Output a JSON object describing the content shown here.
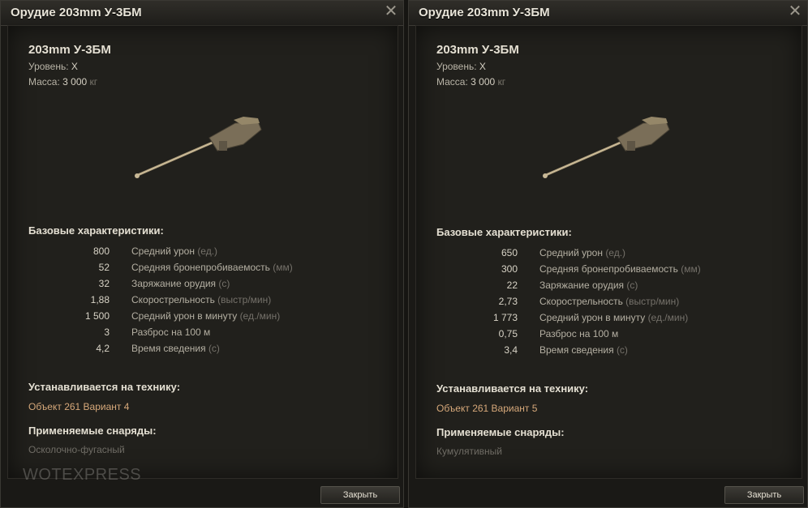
{
  "left": {
    "window_title": "Орудие 203mm У-3БМ",
    "gun_name": "203mm У-3БМ",
    "level_label": "Уровень:",
    "level_value": "X",
    "mass_label": "Масса:",
    "mass_value": "3 000",
    "mass_unit": "кг",
    "base_header": "Базовые характеристики:",
    "stats": [
      {
        "value": "800",
        "label": "Средний урон",
        "unit": "(ед.)"
      },
      {
        "value": "52",
        "label": "Средняя бронепробиваемость",
        "unit": "(мм)"
      },
      {
        "value": "32",
        "label": "Заряжание орудия",
        "unit": "(с)"
      },
      {
        "value": "1,88",
        "label": "Скорострельность",
        "unit": "(выстр/мин)"
      },
      {
        "value": "1 500",
        "label": "Средний урон в минуту",
        "unit": "(ед./мин)"
      },
      {
        "value": "3",
        "label": "Разброс на 100 м",
        "unit": ""
      },
      {
        "value": "4,2",
        "label": "Время сведения",
        "unit": "(с)"
      }
    ],
    "installed_header": "Устанавливается на технику:",
    "vehicle": "Объект 261 Вариант 4",
    "shells_header": "Применяемые снаряды:",
    "shell": "Осколочно-фугасный",
    "close_button": "Закрыть",
    "watermark": "WOTEXPRESS"
  },
  "right": {
    "window_title": "Орудие 203mm У-3БМ",
    "gun_name": "203mm У-3БМ",
    "level_label": "Уровень:",
    "level_value": "X",
    "mass_label": "Масса:",
    "mass_value": "3 000",
    "mass_unit": "кг",
    "base_header": "Базовые характеристики:",
    "stats": [
      {
        "value": "650",
        "label": "Средний урон",
        "unit": "(ед.)"
      },
      {
        "value": "300",
        "label": "Средняя бронепробиваемость",
        "unit": "(мм)"
      },
      {
        "value": "22",
        "label": "Заряжание орудия",
        "unit": "(с)"
      },
      {
        "value": "2,73",
        "label": "Скорострельность",
        "unit": "(выстр/мин)"
      },
      {
        "value": "1 773",
        "label": "Средний урон в минуту",
        "unit": "(ед./мин)"
      },
      {
        "value": "0,75",
        "label": "Разброс на 100 м",
        "unit": ""
      },
      {
        "value": "3,4",
        "label": "Время сведения",
        "unit": "(с)"
      }
    ],
    "installed_header": "Устанавливается на технику:",
    "vehicle": "Объект 261 Вариант 5",
    "shells_header": "Применяемые снаряды:",
    "shell": "Кумулятивный",
    "close_button": "Закрыть"
  },
  "icons": {
    "close": "close-icon",
    "gun": "gun-image"
  },
  "colors": {
    "vehicle_text": "#d6a87a",
    "background": "#1a1916"
  }
}
